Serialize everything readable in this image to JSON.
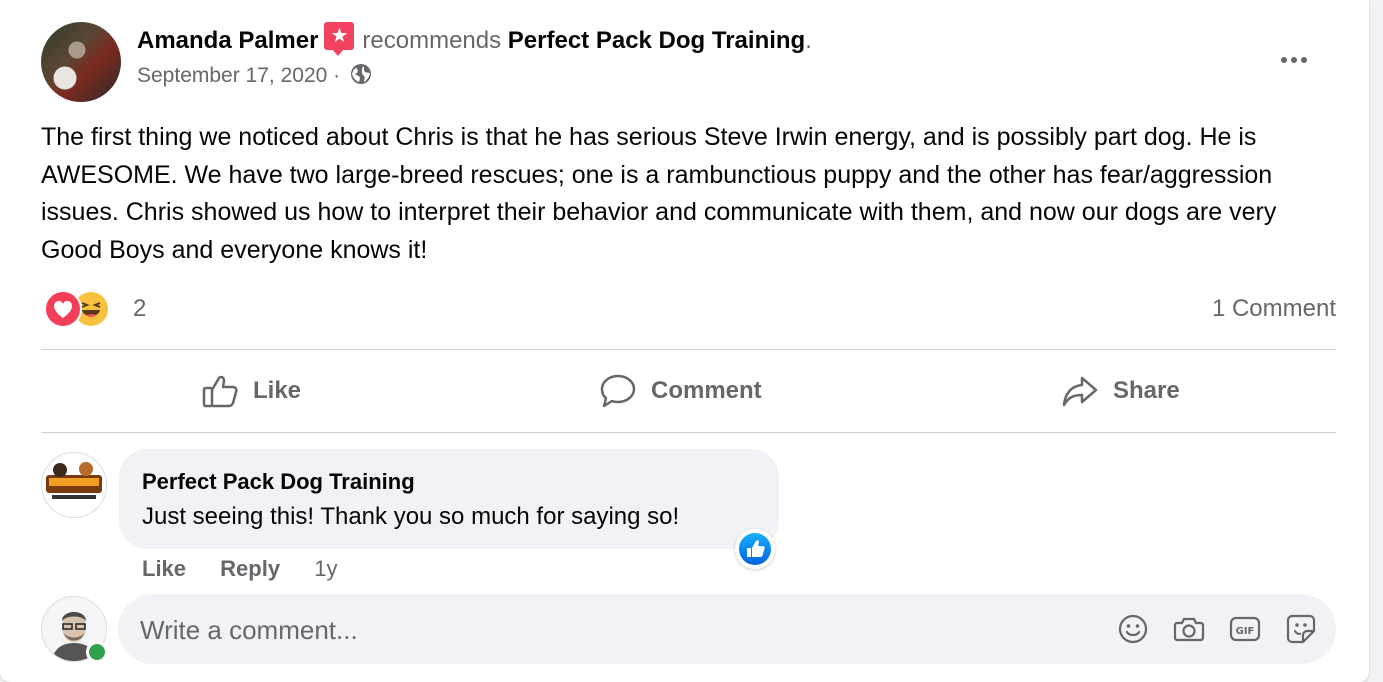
{
  "post": {
    "author": "Amanda Palmer",
    "verb": "recommends",
    "page": "Perfect Pack Dog Training",
    "period": ".",
    "date": "September 17, 2020",
    "separator": "·",
    "audience_icon": "globe-icon",
    "text": "The first thing we noticed about Chris is that he has serious Steve Irwin energy, and is possibly part dog. He is AWESOME. We have two large-breed rescues; one is a rambunctious puppy and the other has fear/aggression issues. Chris showed us how to interpret their behavior and communicate with them, and now our dogs are very Good Boys and everyone knows it!",
    "recommendation_badge_icon": "recommendation-star-icon"
  },
  "reactions": {
    "types": [
      "love",
      "haha"
    ],
    "count": "2",
    "comments": "1 Comment"
  },
  "actions": {
    "like": "Like",
    "comment": "Comment",
    "share": "Share"
  },
  "comment": {
    "author": "Perfect Pack Dog Training",
    "text": "Just seeing this! Thank you so much for saying so!",
    "like": "Like",
    "reply": "Reply",
    "time": "1y",
    "reaction": "like"
  },
  "composer": {
    "placeholder": "Write a comment...",
    "tools": [
      "emoji-icon",
      "camera-icon",
      "gif-icon",
      "sticker-icon"
    ]
  },
  "colors": {
    "accent_blue": "#1877f2",
    "love_red": "#f33e58",
    "haha_yellow": "#f7c23f",
    "online_green": "#31a24c",
    "recommend_pink": "#f3425f"
  }
}
